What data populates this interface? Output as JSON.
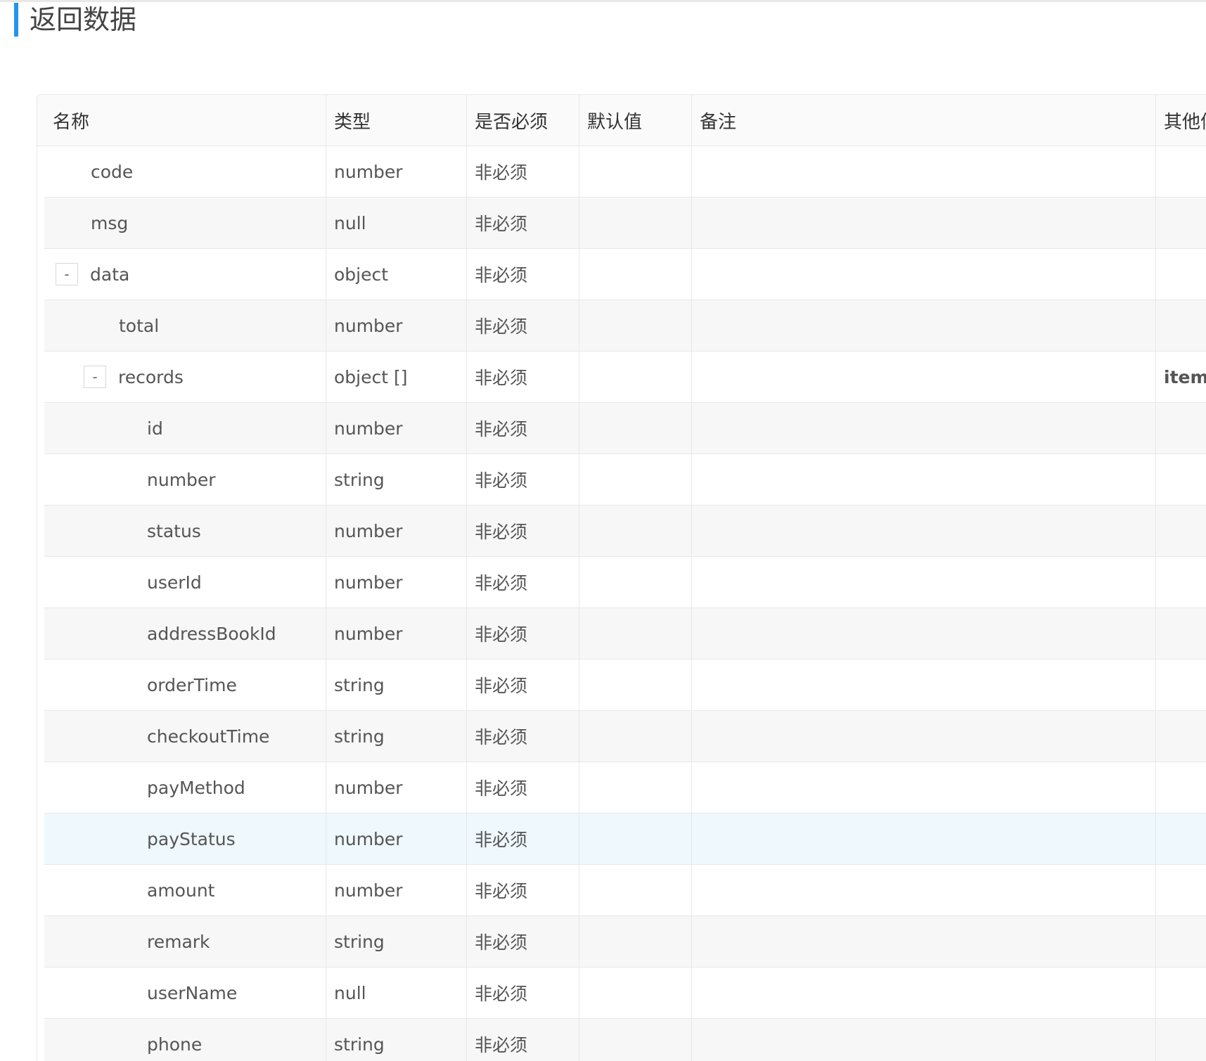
{
  "section": {
    "title": "返回数据"
  },
  "table": {
    "headers": {
      "name": "名称",
      "type": "类型",
      "required": "是否必须",
      "default": "默认值",
      "note": "备注",
      "other": "其他信"
    },
    "rows": [
      {
        "name": "code",
        "type": "number",
        "required": "非必须",
        "level": 1,
        "expander": "",
        "other": ""
      },
      {
        "name": "msg",
        "type": "null",
        "required": "非必须",
        "level": 1,
        "expander": "",
        "other": ""
      },
      {
        "name": "data",
        "type": "object",
        "required": "非必须",
        "level": 1,
        "expander": "-",
        "other": ""
      },
      {
        "name": "total",
        "type": "number",
        "required": "非必须",
        "level": 2,
        "expander": "",
        "other": ""
      },
      {
        "name": "records",
        "type": "object []",
        "required": "非必须",
        "level": 2,
        "expander": "-",
        "other": "item"
      },
      {
        "name": "id",
        "type": "number",
        "required": "非必须",
        "level": 3,
        "expander": "",
        "other": ""
      },
      {
        "name": "number",
        "type": "string",
        "required": "非必须",
        "level": 3,
        "expander": "",
        "other": ""
      },
      {
        "name": "status",
        "type": "number",
        "required": "非必须",
        "level": 3,
        "expander": "",
        "other": ""
      },
      {
        "name": "userId",
        "type": "number",
        "required": "非必须",
        "level": 3,
        "expander": "",
        "other": ""
      },
      {
        "name": "addressBookId",
        "type": "number",
        "required": "非必须",
        "level": 3,
        "expander": "",
        "other": ""
      },
      {
        "name": "orderTime",
        "type": "string",
        "required": "非必须",
        "level": 3,
        "expander": "",
        "other": ""
      },
      {
        "name": "checkoutTime",
        "type": "string",
        "required": "非必须",
        "level": 3,
        "expander": "",
        "other": ""
      },
      {
        "name": "payMethod",
        "type": "number",
        "required": "非必须",
        "level": 3,
        "expander": "",
        "other": ""
      },
      {
        "name": "payStatus",
        "type": "number",
        "required": "非必须",
        "level": 3,
        "expander": "",
        "other": ""
      },
      {
        "name": "amount",
        "type": "number",
        "required": "非必须",
        "level": 3,
        "expander": "",
        "other": ""
      },
      {
        "name": "remark",
        "type": "string",
        "required": "非必须",
        "level": 3,
        "expander": "",
        "other": ""
      },
      {
        "name": "userName",
        "type": "null",
        "required": "非必须",
        "level": 3,
        "expander": "",
        "other": ""
      },
      {
        "name": "phone",
        "type": "string",
        "required": "非必须",
        "level": 3,
        "expander": "",
        "other": ""
      }
    ],
    "hovered_row": "payStatus"
  },
  "colors": {
    "accent": "#2395f1",
    "zebra": "#f7f7f7",
    "hover": "#eef8fd",
    "border": "#e8e8e8"
  }
}
